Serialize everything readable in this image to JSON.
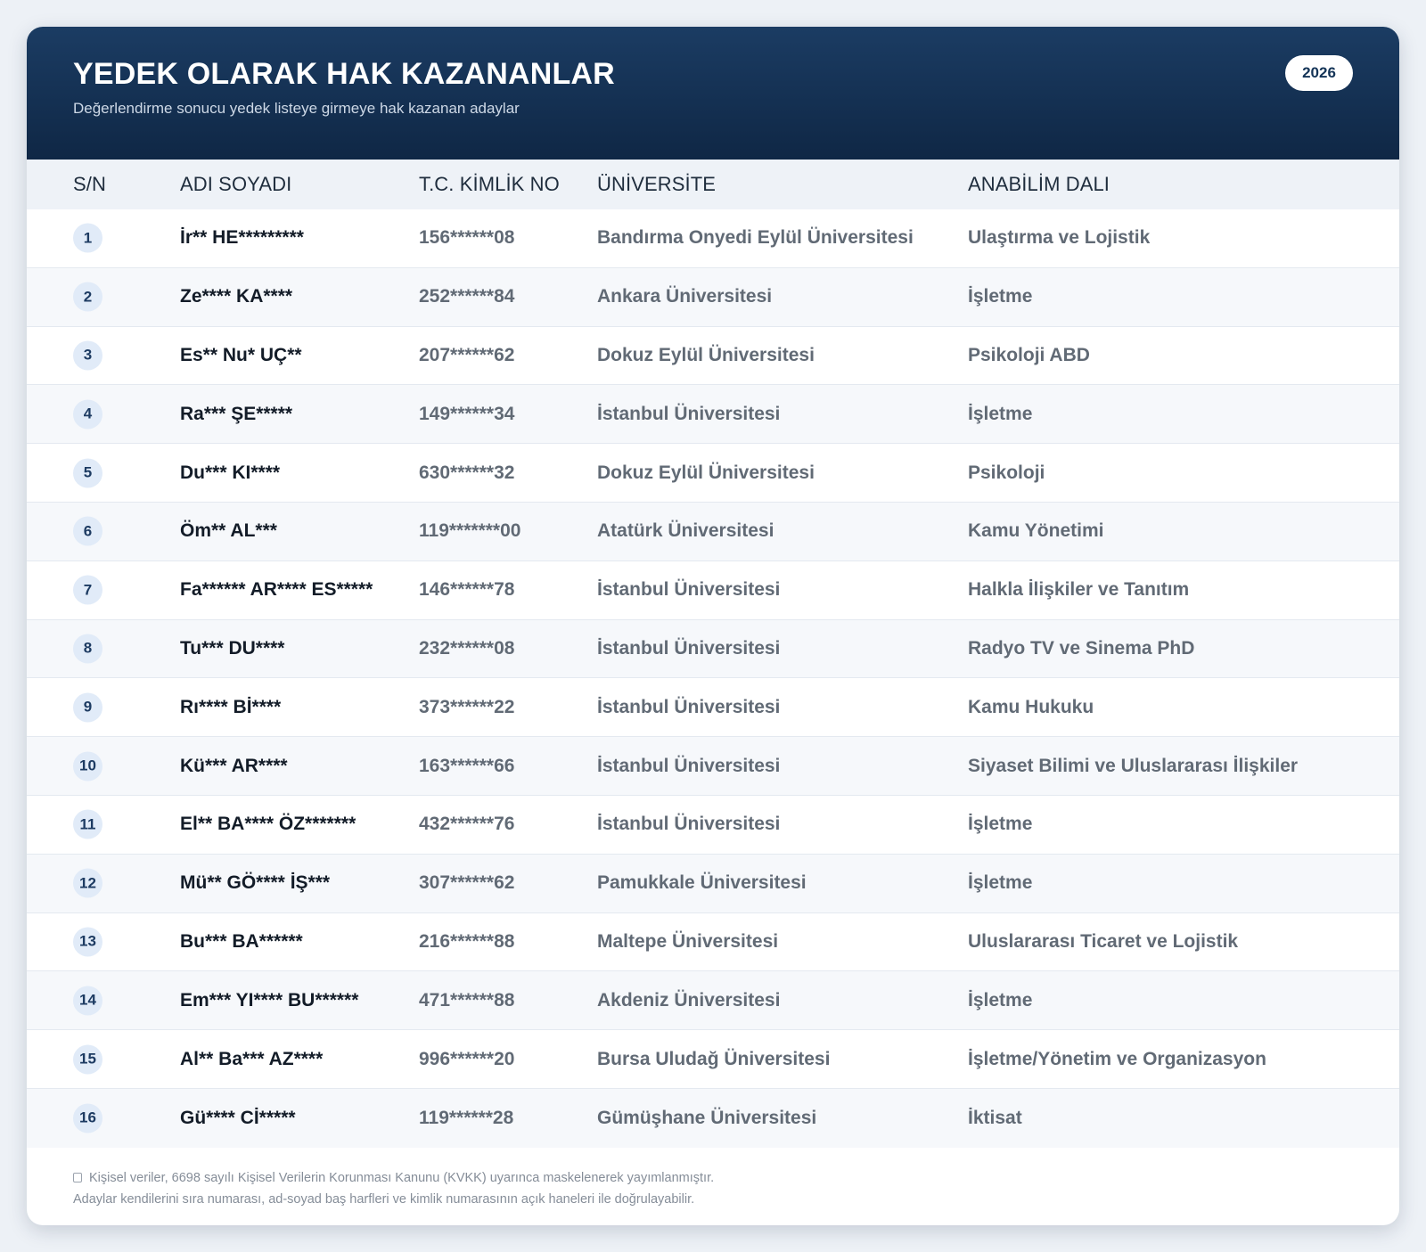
{
  "header": {
    "title": "YEDEK OLARAK HAK KAZANANLAR",
    "subtitle": "Değerlendirme sonucu yedek listeye girmeye hak kazanan adaylar",
    "year": "2026"
  },
  "table": {
    "columns": [
      "S/N",
      "ADI SOYADI",
      "T.C. KİMLİK NO",
      "ÜNİVERSİTE",
      "ANABİLİM DALI"
    ],
    "rows": [
      {
        "sn": "1",
        "name": "İr** HE*********",
        "tc": "156******08",
        "university": "Bandırma Onyedi Eylül Üniversitesi",
        "department": "Ulaştırma ve Lojistik"
      },
      {
        "sn": "2",
        "name": "Ze**** KA****",
        "tc": "252******84",
        "university": "Ankara Üniversitesi",
        "department": "İşletme"
      },
      {
        "sn": "3",
        "name": "Es** Nu* UÇ**",
        "tc": "207******62",
        "university": "Dokuz Eylül Üniversitesi",
        "department": "Psikoloji ABD"
      },
      {
        "sn": "4",
        "name": "Ra*** ŞE*****",
        "tc": "149******34",
        "university": "İstanbul Üniversitesi",
        "department": "İşletme"
      },
      {
        "sn": "5",
        "name": "Du*** KI****",
        "tc": "630******32",
        "university": "Dokuz Eylül Üniversitesi",
        "department": "Psikoloji"
      },
      {
        "sn": "6",
        "name": "Öm** AL***",
        "tc": "119*******00",
        "university": "Atatürk Üniversitesi",
        "department": "Kamu Yönetimi"
      },
      {
        "sn": "7",
        "name": "Fa****** AR**** ES*****",
        "tc": "146******78",
        "university": "İstanbul Üniversitesi",
        "department": "Halkla İlişkiler ve Tanıtım"
      },
      {
        "sn": "8",
        "name": "Tu*** DU****",
        "tc": "232******08",
        "university": "İstanbul Üniversitesi",
        "department": "Radyo TV ve Sinema PhD"
      },
      {
        "sn": "9",
        "name": "Rı**** Bİ****",
        "tc": "373******22",
        "university": "İstanbul Üniversitesi",
        "department": "Kamu Hukuku"
      },
      {
        "sn": "10",
        "name": "Kü*** AR****",
        "tc": "163******66",
        "university": "İstanbul Üniversitesi",
        "department": "Siyaset Bilimi ve Uluslararası İlişkiler"
      },
      {
        "sn": "11",
        "name": "El** BA**** ÖZ*******",
        "tc": "432******76",
        "university": "İstanbul Üniversitesi",
        "department": "İşletme"
      },
      {
        "sn": "12",
        "name": "Mü** GÖ**** İŞ***",
        "tc": "307******62",
        "university": "Pamukkale Üniversitesi",
        "department": "İşletme"
      },
      {
        "sn": "13",
        "name": "Bu*** BA******",
        "tc": "216******88",
        "university": "Maltepe Üniversitesi",
        "department": "Uluslararası Ticaret ve Lojistik"
      },
      {
        "sn": "14",
        "name": "Em*** YI**** BU******",
        "tc": "471******88",
        "university": "Akdeniz Üniversitesi",
        "department": "İşletme"
      },
      {
        "sn": "15",
        "name": "Al** Ba*** AZ****",
        "tc": "996******20",
        "university": "Bursa Uludağ Üniversitesi",
        "department": "İşletme/Yönetim ve Organizasyon"
      },
      {
        "sn": "16",
        "name": "Gü**** Cİ*****",
        "tc": "119******28",
        "university": "Gümüşhane Üniversitesi",
        "department": "İktisat"
      }
    ]
  },
  "footer": {
    "note_line1": "Kişisel veriler, 6698 sayılı Kişisel Verilerin Korunması Kanunu (KVKK) uyarınca maskelenerek yayımlanmıştır.",
    "note_line2": "Adaylar kendilerini sıra numarası, ad-soyad baş harfleri ve kimlik numarasının açık haneleri ile doğrulayabilir.",
    "icon": "lock-icon"
  },
  "colors": {
    "header_top": "#1b3c63",
    "header_bottom": "#0f2745",
    "badge_bg": "#e1ebf8",
    "badge_text": "#1d3b62"
  }
}
